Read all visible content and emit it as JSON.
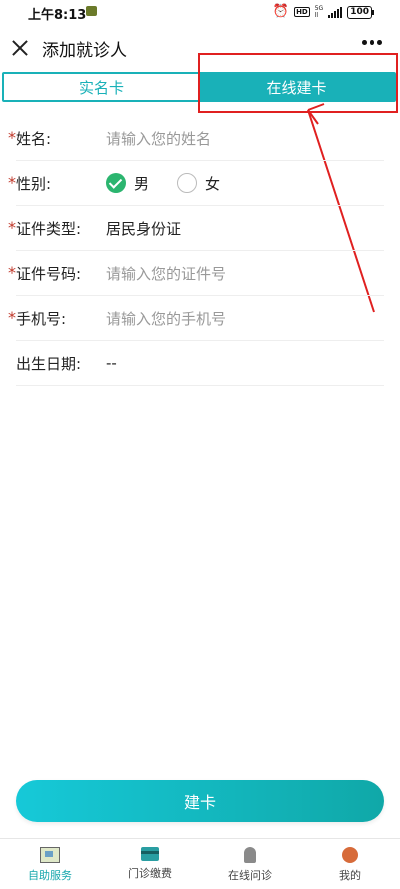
{
  "status_bar": {
    "time": "上午8:13",
    "hd": "HD",
    "network_top": "5G",
    "network_bottom": "ll",
    "battery": "100"
  },
  "header": {
    "title": "添加就诊人"
  },
  "tabs": [
    {
      "label": "实名卡"
    },
    {
      "label": "在线建卡"
    }
  ],
  "form": {
    "name": {
      "label": "姓名:",
      "placeholder": "请输入您的姓名"
    },
    "gender": {
      "label": "性别:",
      "options": [
        "男",
        "女"
      ],
      "selected": "男"
    },
    "id_type": {
      "label": "证件类型:",
      "value": "居民身份证"
    },
    "id_number": {
      "label": "证件号码:",
      "placeholder": "请输入您的证件号"
    },
    "phone": {
      "label": "手机号:",
      "placeholder": "请输入您的手机号"
    },
    "birthday": {
      "label": "出生日期:",
      "value": "--"
    },
    "required_mark": "*"
  },
  "submit": {
    "label": "建卡"
  },
  "bottom_nav": [
    {
      "label": "自助服务",
      "icon": "self-service-icon"
    },
    {
      "label": "门诊缴费",
      "icon": "card-icon"
    },
    {
      "label": "在线问诊",
      "icon": "doctor-icon"
    },
    {
      "label": "我的",
      "icon": "profile-icon"
    }
  ],
  "colors": {
    "accent": "#19b1b8",
    "annotation": "#e02020",
    "check": "#2bb56f"
  }
}
